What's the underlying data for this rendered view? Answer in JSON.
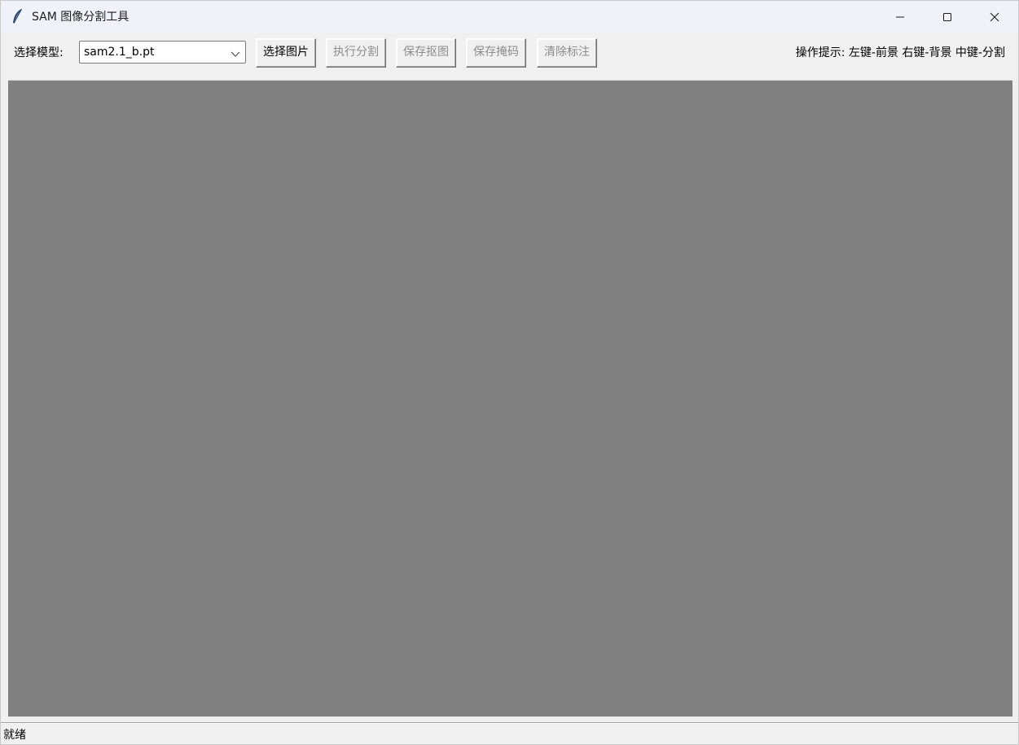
{
  "window": {
    "title": "SAM 图像分割工具",
    "app_icon": "feather-icon",
    "controls": [
      "minimize-icon",
      "maximize-icon",
      "close-icon"
    ]
  },
  "toolbar": {
    "model_label": "选择模型:",
    "model_value": "sam2.1_b.pt",
    "buttons": [
      {
        "label": "选择图片",
        "enabled": true
      },
      {
        "label": "执行分割",
        "enabled": false
      },
      {
        "label": "保存抠图",
        "enabled": false
      },
      {
        "label": "保存掩码",
        "enabled": false
      },
      {
        "label": "清除标注",
        "enabled": false
      }
    ],
    "hint": "操作提示: 左键-前景 右键-背景 中键-分割"
  },
  "canvas": {
    "background": "#808080"
  },
  "status": {
    "text": "就绪"
  }
}
